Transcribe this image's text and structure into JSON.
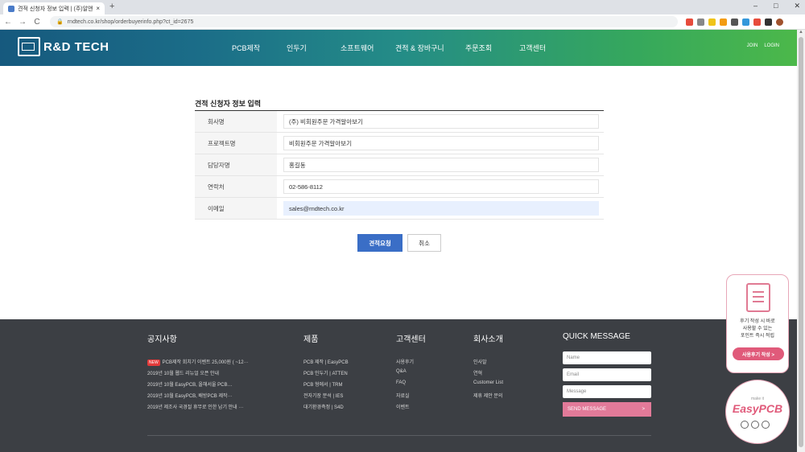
{
  "browser": {
    "tab_title": "견적 신청자 정보 입력 | (주)알앤...",
    "new_tab": "+",
    "close": "×",
    "url": "rndtech.co.kr/shop/orderbuyerinfo.php?ct_id=2675",
    "back": "←",
    "forward": "→",
    "reload": "C",
    "lock": "🔒",
    "min": "–",
    "max": "□",
    "win_close": "✕"
  },
  "header": {
    "logo": "R&D TECH",
    "nav": [
      "PCB제작",
      "인두기",
      "소프트웨어",
      "견적 & 장바구니",
      "주문조회",
      "고객센터"
    ],
    "util": [
      "JOIN",
      "LOGIN"
    ]
  },
  "form": {
    "title": "견적 신청자 정보 입력",
    "rows": [
      {
        "label": "회사명",
        "value": "(주) 비회원주문 가격알아보기"
      },
      {
        "label": "프로젝트명",
        "value": "비회원주문 가격알아보기"
      },
      {
        "label": "담당자명",
        "value": "홍길동"
      },
      {
        "label": "연락처",
        "value": "02-586-8112"
      },
      {
        "label": "이메일",
        "value": "sales@rndtech.co.kr"
      }
    ],
    "submit": "견적요청",
    "cancel": "취소"
  },
  "footer": {
    "notice": {
      "title": "공지사항",
      "badge": "NEW",
      "items": [
        "PCB제작 회치기 이벤트 25,000원 ( ~12···",
        "2019년 10월 웹드 리뉴얼 오픈 안내",
        "2019년 10월 EasyPCB, 올해서울 PCB…",
        "2019년 10월 EasyPCB, 배방PCB 제작···",
        "2019년 제조사 국경절 휴무로 인한 납기 안내 ···"
      ]
    },
    "products": {
      "title": "제품",
      "items": [
        "PCB 제작 | EasyPCB",
        "PCB 인두기 | ATTEN",
        "PCB 형에서 | TRM",
        "전자기장 분석 | IES",
        "대기환경측정 | S4D"
      ]
    },
    "support": {
      "title": "고객센터",
      "items": [
        "사용후기",
        "Q&A",
        "FAQ",
        "자료실",
        "이벤트"
      ]
    },
    "company": {
      "title": "회사소개",
      "items": [
        "인사말",
        "연혁",
        "Customer List",
        "제휴 제안 문의"
      ]
    },
    "qm": {
      "title": "QUICK MESSAGE",
      "name": "Name",
      "email": "Email",
      "message": "Message",
      "send": "SEND MESSAGE",
      "arrow": ">"
    }
  },
  "side": {
    "review_text": "후기 작성 시 바로\n사용할 수 있는\n포인트 즉시 적립",
    "review_btn": "사용후기 작성 >",
    "make_it": "make it",
    "easypcb": "EasyPCB"
  }
}
